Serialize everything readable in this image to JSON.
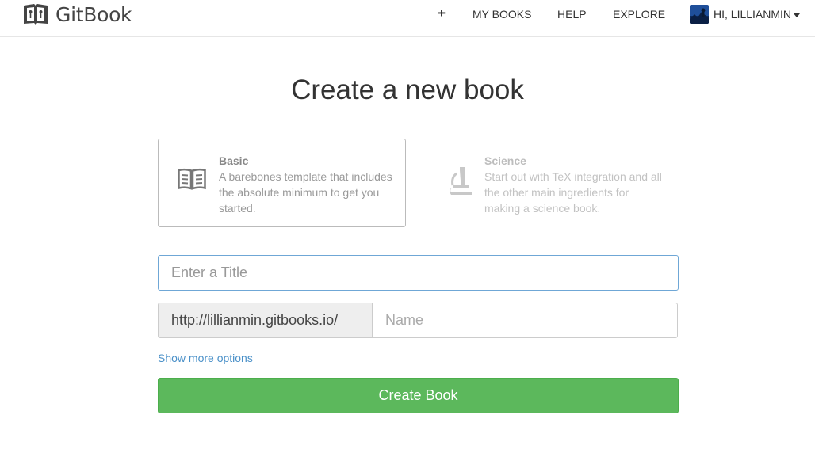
{
  "header": {
    "brand": "GitBook",
    "nav": {
      "plus": "+",
      "my_books": "MY BOOKS",
      "help": "HELP",
      "explore": "EXPLORE",
      "user_greeting": "HI, LILLIANMIN"
    }
  },
  "main": {
    "title": "Create a new book",
    "templates": [
      {
        "name": "Basic",
        "description": "A barebones template that includes the absolute minimum to get you started.",
        "icon": "open-book-icon",
        "selected": true
      },
      {
        "name": "Science",
        "description": "Start out with TeX integration and all the other main ingredients for making a science book.",
        "icon": "microscope-icon",
        "selected": false
      }
    ],
    "title_input": {
      "placeholder": "Enter a Title",
      "value": ""
    },
    "url_prefix": "http://lillianmin.gitbooks.io/",
    "name_input": {
      "placeholder": "Name",
      "value": ""
    },
    "more_options": "Show more options",
    "create_button": "Create Book"
  },
  "colors": {
    "primary_button": "#5cb85c",
    "link": "#4a90c8",
    "input_focus_border": "#6fa7d6"
  }
}
